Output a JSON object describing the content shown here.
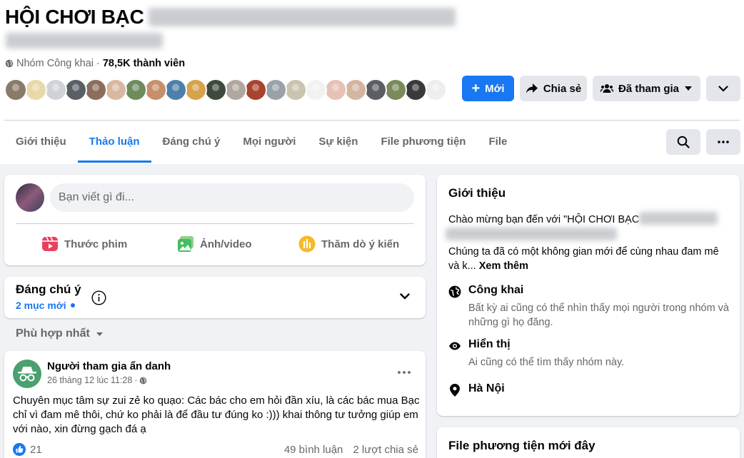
{
  "group": {
    "name": "HỘI CHƠI BẠC",
    "privacy": "Nhóm Công khai",
    "separator": "·",
    "members": "78,5K thành viên"
  },
  "avatars": [
    "#8a7a6a",
    "#e8d9a8",
    "#cfd3d8",
    "#5a5f66",
    "#8b6d5c",
    "#d9b8a0",
    "#6e8b5e",
    "#c78f6a",
    "#4d7fa8",
    "#d6a34a",
    "#3f4a3c",
    "#b0a8a0",
    "#a8432e",
    "#9aa2a8",
    "#c9c4b0",
    "#f2f2f2",
    "#e7c2b4",
    "#d4b5a0",
    "#5b5e63",
    "#7a8a5a",
    "#3a3a3a",
    "#eeeeee"
  ],
  "actions": {
    "new": "Mới",
    "share": "Chia sẻ",
    "joined": "Đã tham gia"
  },
  "tabs": [
    "Giới thiệu",
    "Thảo luận",
    "Đáng chú ý",
    "Mọi người",
    "Sự kiện",
    "File phương tiện",
    "File"
  ],
  "composer": {
    "placeholder": "Bạn viết gì đi...",
    "reel": "Thước phim",
    "photo": "Ảnh/video",
    "poll": "Thăm dò ý kiến"
  },
  "featured": {
    "title": "Đáng chú ý",
    "new_items": "2 mục mới"
  },
  "sort": {
    "label": "Phù hợp nhất"
  },
  "post": {
    "author": "Người tham gia ẩn danh",
    "time": "26 tháng 12 lúc 11:28",
    "separator": "·",
    "text": "Chuyên mục tâm sự zui zẻ ko quạo: Các bác cho em hỏi đần xíu, là các bác mua Bạc chỉ vì đam mê thôi, chứ ko phải là để đầu tư đúng ko :))) khai thông tư tưởng giúp em với nào, xin đừng gạch đá ạ",
    "reactions": "21",
    "comments": "49 bình luận",
    "shares": "2 lượt chia sẻ"
  },
  "about": {
    "title": "Giới thiệu",
    "welcome": "Chào mừng bạn đến với \"HỘI CHƠI BẠC",
    "description": "Chúng ta đã có một không gian mới để cùng nhau đam mê và k...",
    "see_more": "Xem thêm",
    "public_title": "Công khai",
    "public_desc": "Bất kỳ ai cũng có thể nhìn thấy mọi người trong nhóm và những gì họ đăng.",
    "visible_title": "Hiển thị",
    "visible_desc": "Ai cũng có thể tìm thấy nhóm này.",
    "location": "Hà Nội"
  },
  "media": {
    "title": "File phương tiện mới đây"
  },
  "colors": {
    "accent": "#1877f2",
    "background": "#f0f2f5",
    "secondary_text": "#65676b"
  }
}
